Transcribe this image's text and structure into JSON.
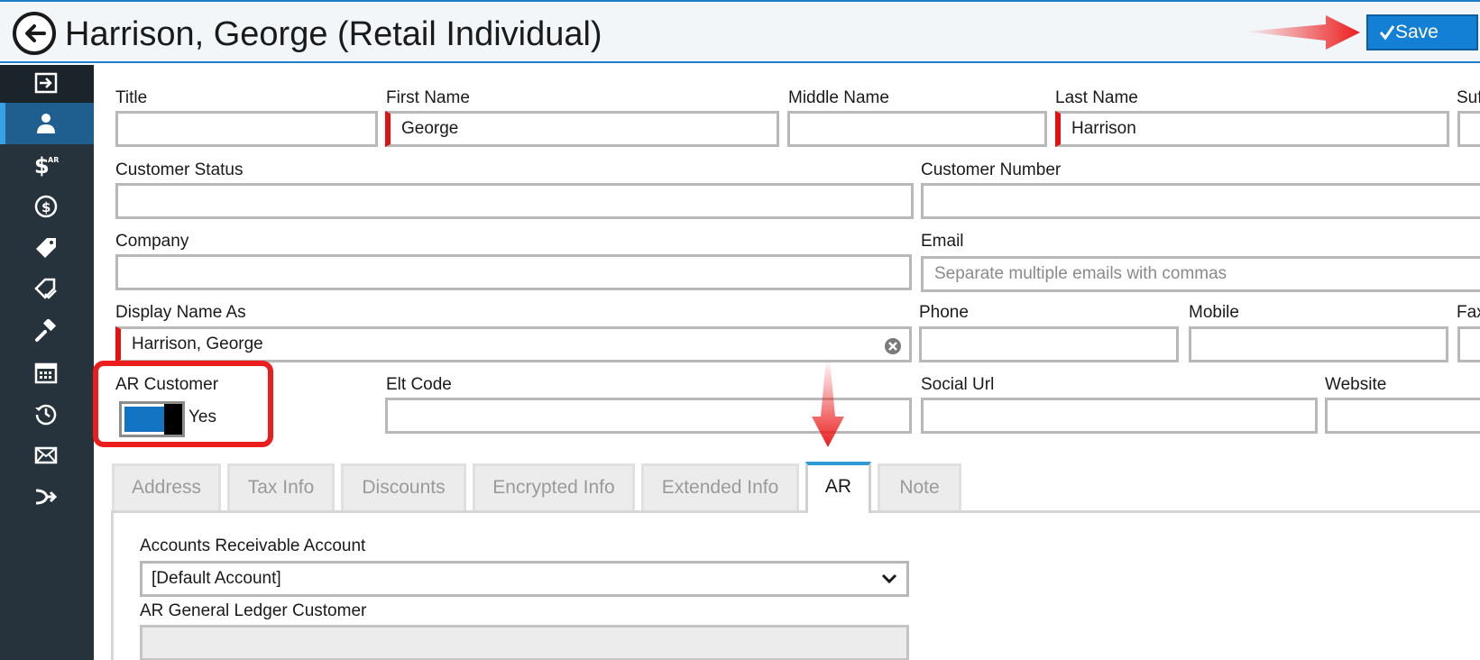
{
  "header": {
    "title": "Harrison, George (Retail Individual)",
    "save_label": "Save"
  },
  "sidebar": {
    "items": [
      {
        "icon": "exit-icon"
      },
      {
        "icon": "user-icon",
        "active": true
      },
      {
        "icon": "ar-dollar-icon"
      },
      {
        "icon": "dollar-circle-icon"
      },
      {
        "icon": "tag-icon"
      },
      {
        "icon": "tag-check-icon"
      },
      {
        "icon": "gavel-icon"
      },
      {
        "icon": "calendar-icon"
      },
      {
        "icon": "history-icon"
      },
      {
        "icon": "envelope-icon"
      },
      {
        "icon": "merge-icon"
      }
    ]
  },
  "form": {
    "title_label": "Title",
    "title_value": "",
    "first_name_label": "First Name",
    "first_name_value": "George",
    "middle_name_label": "Middle Name",
    "middle_name_value": "",
    "last_name_label": "Last Name",
    "last_name_value": "Harrison",
    "suffix_label": "Suf",
    "customer_status_label": "Customer Status",
    "customer_status_value": "",
    "customer_number_label": "Customer Number",
    "customer_number_value": "",
    "company_label": "Company",
    "company_value": "",
    "email_label": "Email",
    "email_placeholder": "Separate multiple emails with commas",
    "display_name_label": "Display Name As",
    "display_name_value": "Harrison, George",
    "phone_label": "Phone",
    "mobile_label": "Mobile",
    "fax_label": "Fax",
    "ar_customer_label": "AR Customer",
    "ar_customer_value": "Yes",
    "elt_code_label": "Elt Code",
    "social_url_label": "Social Url",
    "website_label": "Website"
  },
  "tabs": [
    {
      "label": "Address",
      "active": false
    },
    {
      "label": "Tax Info",
      "active": false
    },
    {
      "label": "Discounts",
      "active": false
    },
    {
      "label": "Encrypted Info",
      "active": false
    },
    {
      "label": "Extended Info",
      "active": false
    },
    {
      "label": "AR",
      "active": true
    },
    {
      "label": "Note",
      "active": false
    }
  ],
  "ar_panel": {
    "account_label": "Accounts Receivable Account",
    "account_value": "[Default Account]",
    "gl_customer_label": "AR General Ledger Customer",
    "gl_customer_value": ""
  },
  "colors": {
    "accent": "#1380d6",
    "sidebar": "#27333c",
    "required": "#e21212",
    "annotation": "#ec1d1d"
  }
}
